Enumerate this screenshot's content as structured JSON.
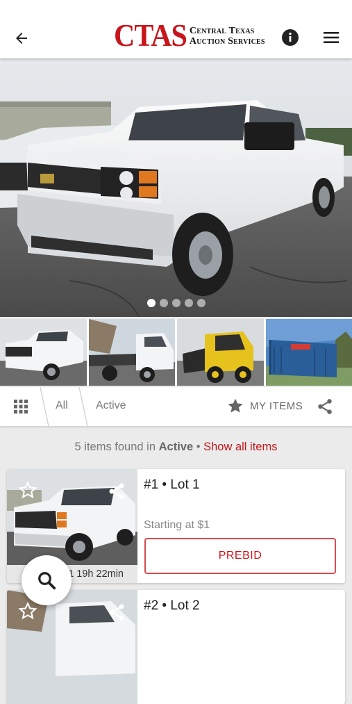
{
  "header": {
    "logo_main": "CTAS",
    "logo_line1": "Central Texas",
    "logo_line2": "Auction Services",
    "icons": [
      "arrow-back-icon",
      "info-icon",
      "menu-icon"
    ]
  },
  "gallery": {
    "slide_count": 5,
    "active_slide": 1,
    "thumbnails": [
      "white-pickup-truck",
      "white-flatbed-truck",
      "yellow-skid-steer",
      "blue-shipping-container"
    ]
  },
  "filters": {
    "tab_all": "All",
    "tab_active": "Active",
    "my_items": "MY ITEMS"
  },
  "summary": {
    "prefix": "5 items found in ",
    "status": "Active",
    "separator": " • ",
    "show_all": "Show all items"
  },
  "lots": [
    {
      "title": "#1 • Lot 1",
      "starting": "Starting at $1",
      "prebid": "PREBID",
      "timer": "1 19h 22min"
    },
    {
      "title": "#2 • Lot 2"
    }
  ],
  "colors": {
    "brand_red": "#c8161d",
    "background": "#ebebeb"
  }
}
